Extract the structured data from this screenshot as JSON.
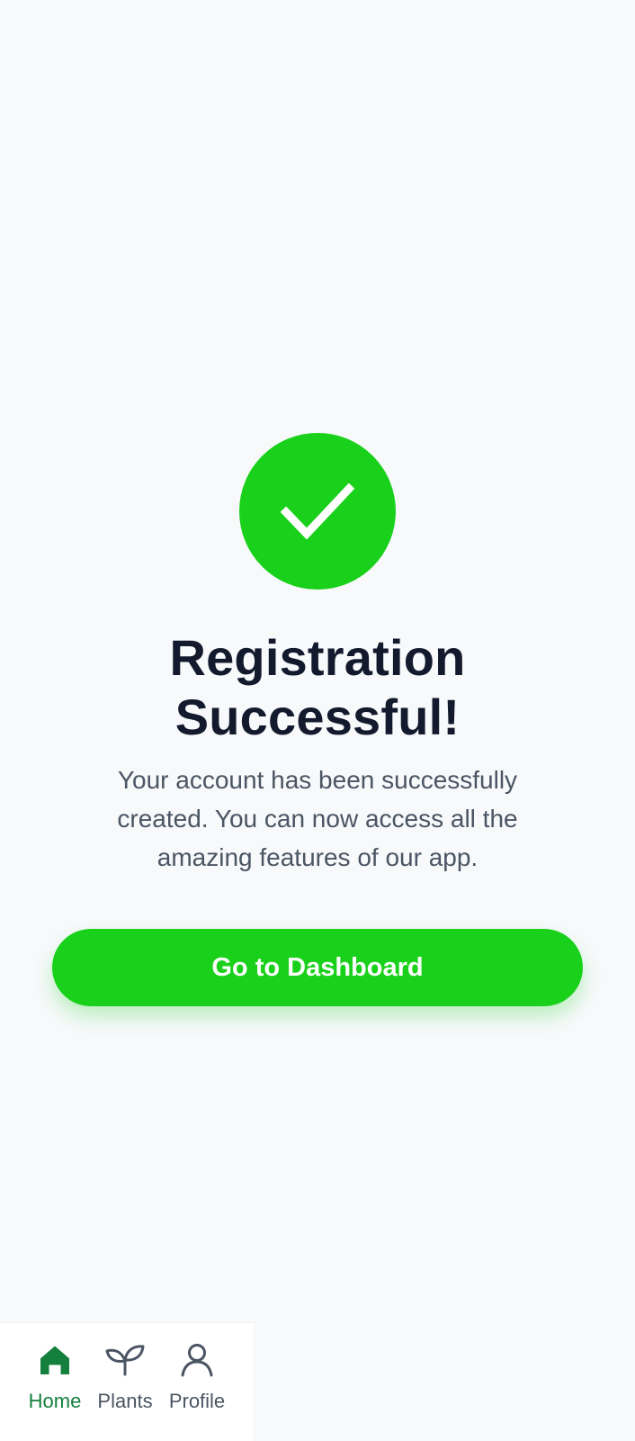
{
  "success": {
    "icon": "checkmark-icon",
    "title": "Registration Successful!",
    "message": "Your account has been successfully created. You can now access all the amazing features of our app.",
    "button_label": "Go to Dashboard"
  },
  "bottom_nav": {
    "items": [
      {
        "label": "Home",
        "icon": "home-icon",
        "active": true
      },
      {
        "label": "Plants",
        "icon": "leaf-icon",
        "active": false
      },
      {
        "label": "Profile",
        "icon": "user-icon",
        "active": false
      }
    ]
  },
  "colors": {
    "accent": "#19d11a",
    "active_nav": "#15803d",
    "title": "#141a2e",
    "body_text": "#4b5563",
    "background": "#f7f9fb"
  }
}
